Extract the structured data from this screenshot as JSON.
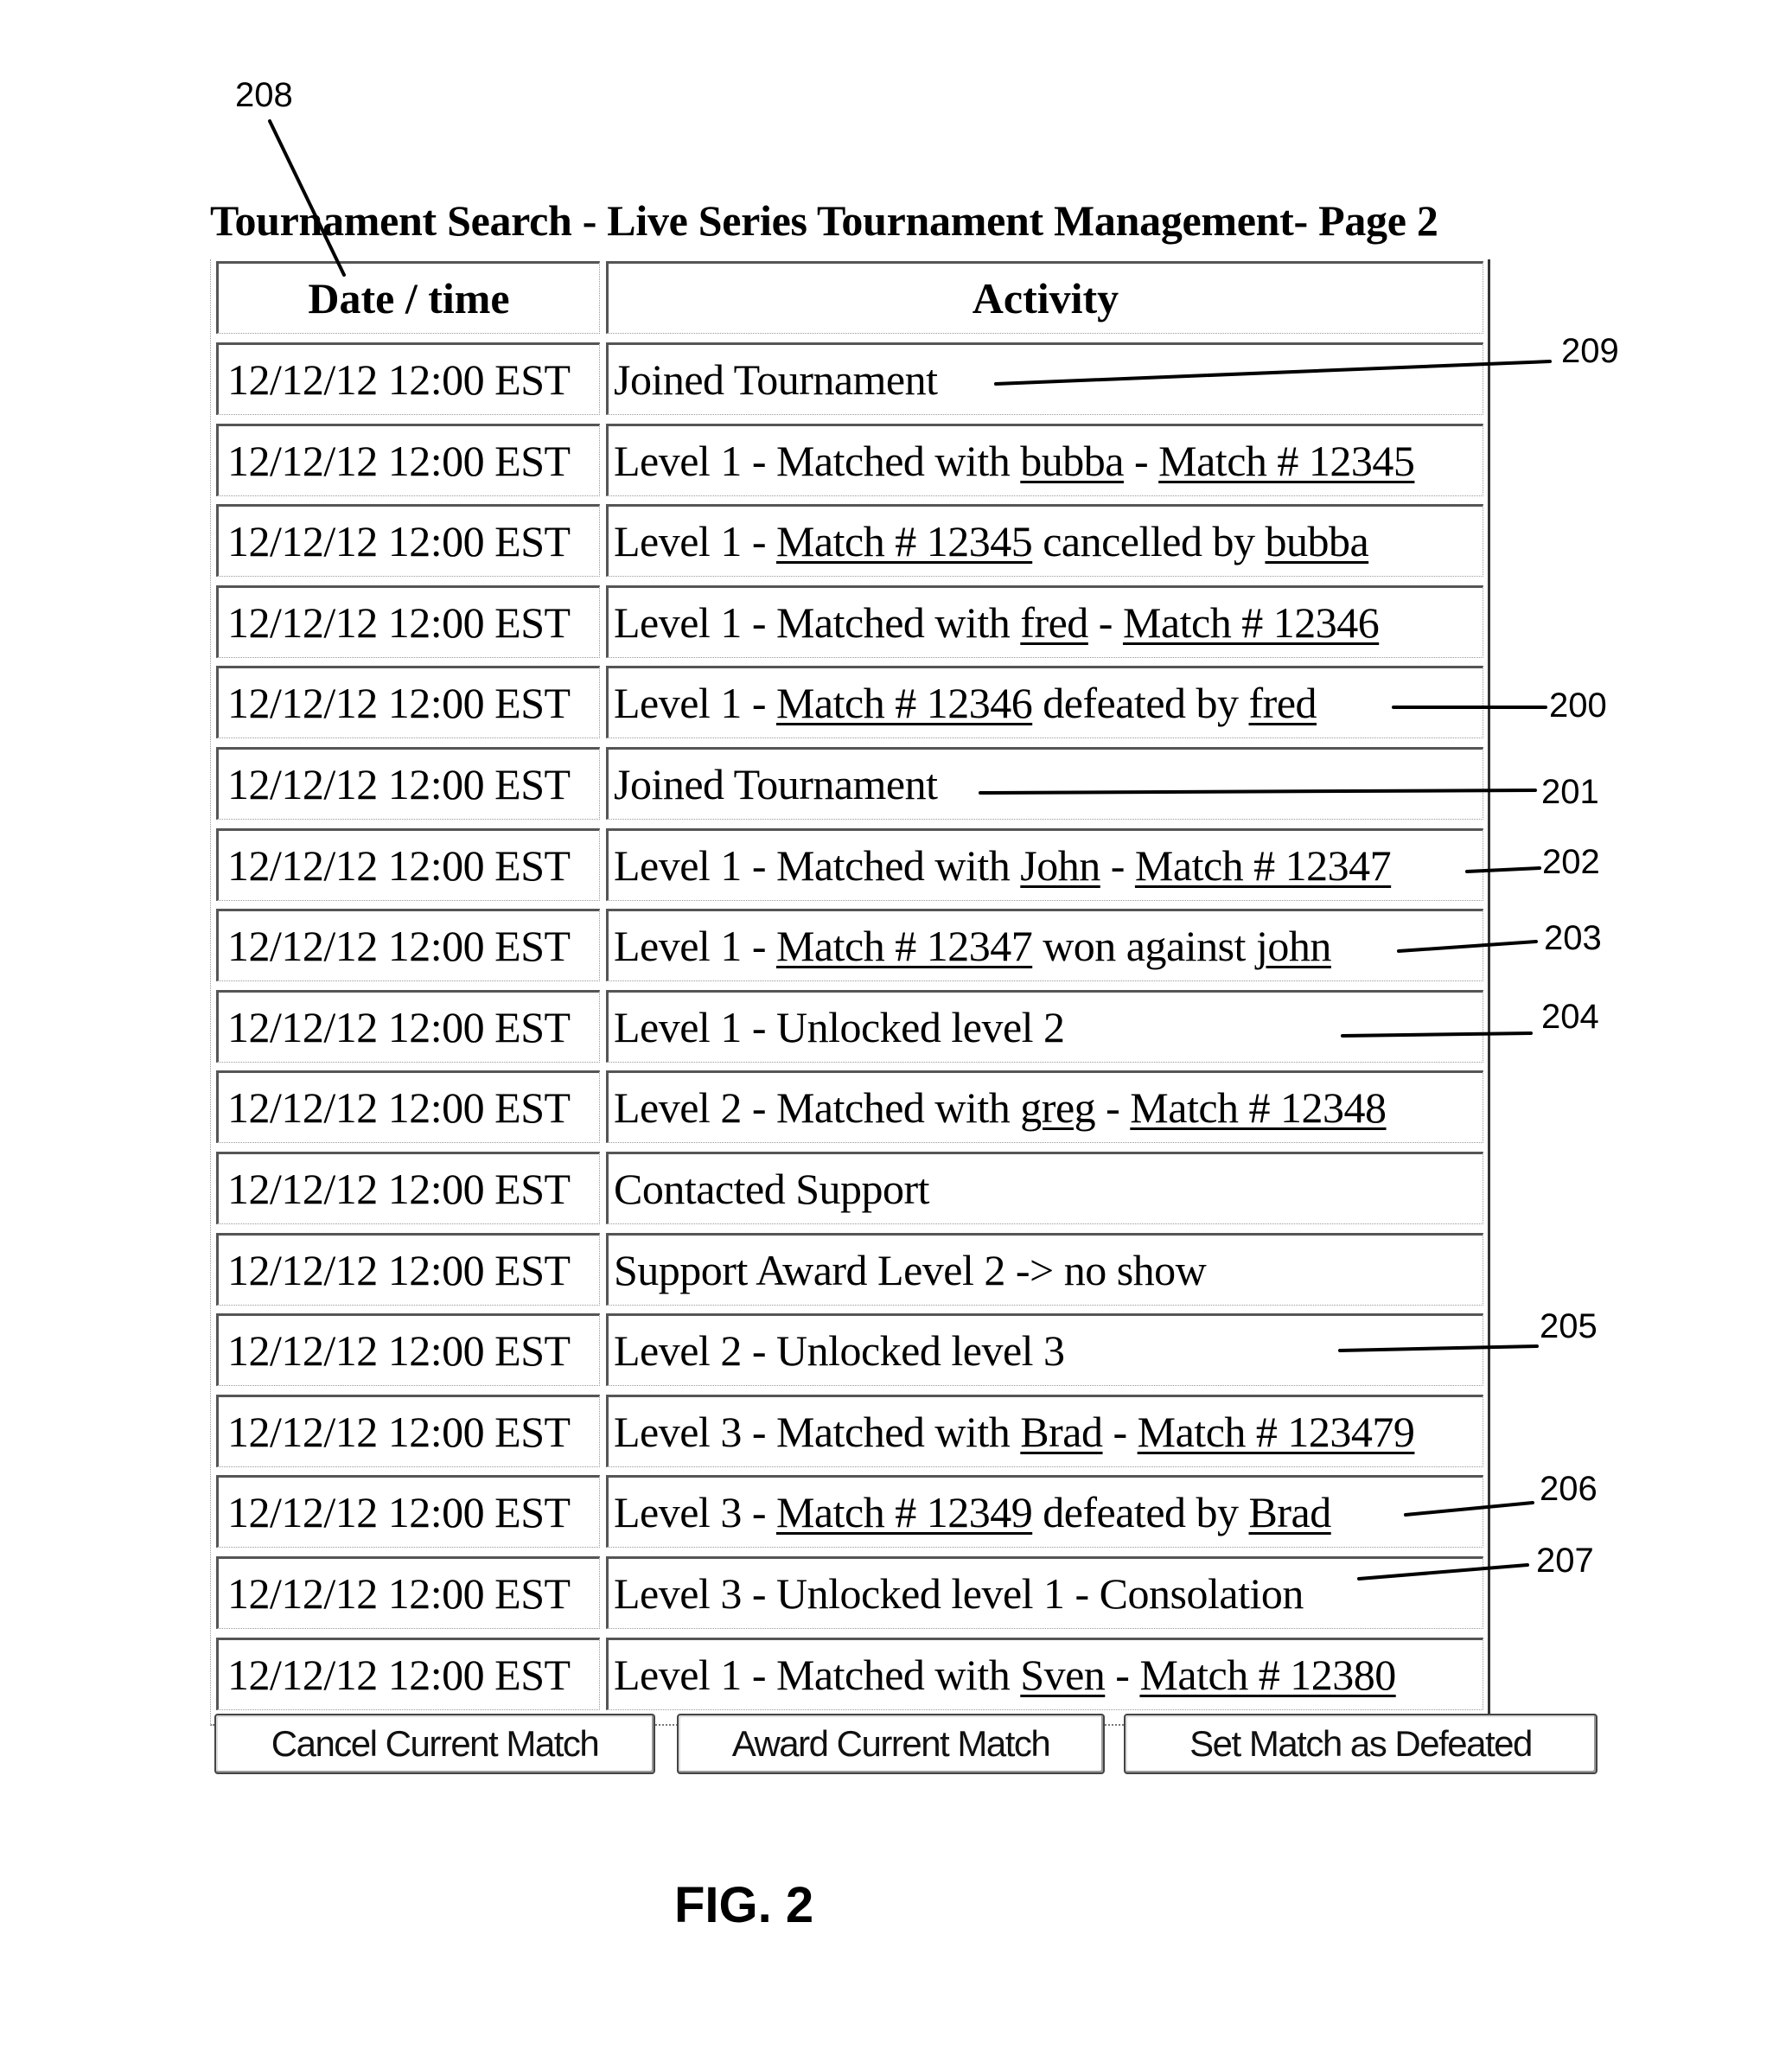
{
  "page": {
    "title": "Tournament Search - Live Series Tournament Management- Page 2",
    "figure_label": "FIG. 2"
  },
  "table": {
    "headers": [
      "Date / time",
      "Activity"
    ],
    "rows": [
      {
        "datetime": "12/12/12 12:00 EST",
        "activity": [
          {
            "t": "Joined Tournament"
          }
        ]
      },
      {
        "datetime": "12/12/12 12:00 EST",
        "activity": [
          {
            "t": "Level 1 - Matched with "
          },
          {
            "t": "bubba",
            "link": true
          },
          {
            "t": " - "
          },
          {
            "t": "Match # 12345",
            "link": true
          }
        ]
      },
      {
        "datetime": "12/12/12 12:00 EST",
        "activity": [
          {
            "t": "Level 1 - "
          },
          {
            "t": "Match # 12345",
            "link": true
          },
          {
            "t": " cancelled by "
          },
          {
            "t": "bubba",
            "link": true
          }
        ]
      },
      {
        "datetime": "12/12/12 12:00 EST",
        "activity": [
          {
            "t": "Level 1 - Matched with "
          },
          {
            "t": "fred",
            "link": true
          },
          {
            "t": " - "
          },
          {
            "t": "Match # 12346",
            "link": true
          }
        ]
      },
      {
        "datetime": "12/12/12 12:00 EST",
        "activity": [
          {
            "t": "Level 1 - "
          },
          {
            "t": "Match # 12346",
            "link": true
          },
          {
            "t": " defeated by "
          },
          {
            "t": "fred",
            "link": true
          }
        ]
      },
      {
        "datetime": "12/12/12 12:00 EST",
        "activity": [
          {
            "t": "Joined Tournament"
          }
        ]
      },
      {
        "datetime": "12/12/12 12:00 EST",
        "activity": [
          {
            "t": "Level 1 - Matched with "
          },
          {
            "t": "John",
            "link": true
          },
          {
            "t": " - "
          },
          {
            "t": "Match # 12347",
            "link": true
          }
        ]
      },
      {
        "datetime": "12/12/12 12:00 EST",
        "activity": [
          {
            "t": "Level 1 - "
          },
          {
            "t": "Match # 12347",
            "link": true
          },
          {
            "t": " won against "
          },
          {
            "t": "john",
            "link": true
          }
        ]
      },
      {
        "datetime": "12/12/12 12:00 EST",
        "activity": [
          {
            "t": "Level 1 - Unlocked level 2"
          }
        ]
      },
      {
        "datetime": "12/12/12 12:00 EST",
        "activity": [
          {
            "t": "Level 2 - Matched with "
          },
          {
            "t": "greg",
            "link": true
          },
          {
            "t": " - "
          },
          {
            "t": "Match # 12348",
            "link": true
          }
        ]
      },
      {
        "datetime": "12/12/12 12:00 EST",
        "activity": [
          {
            "t": "Contacted Support"
          }
        ]
      },
      {
        "datetime": "12/12/12 12:00 EST",
        "activity": [
          {
            "t": "Support Award Level 2 -> no show"
          }
        ]
      },
      {
        "datetime": "12/12/12 12:00 EST",
        "activity": [
          {
            "t": "Level 2 - Unlocked level 3"
          }
        ]
      },
      {
        "datetime": "12/12/12 12:00 EST",
        "activity": [
          {
            "t": "Level 3 - Matched with "
          },
          {
            "t": "Brad",
            "link": true
          },
          {
            "t": " - "
          },
          {
            "t": "Match # 123479",
            "link": true
          }
        ]
      },
      {
        "datetime": "12/12/12 12:00 EST",
        "activity": [
          {
            "t": "Level 3 - "
          },
          {
            "t": "Match # 12349",
            "link": true
          },
          {
            "t": " defeated by "
          },
          {
            "t": "Brad",
            "link": true
          }
        ]
      },
      {
        "datetime": "12/12/12 12:00 EST",
        "activity": [
          {
            "t": "Level 3 - Unlocked level 1 - Consolation"
          }
        ]
      },
      {
        "datetime": "12/12/12 12:00 EST",
        "activity": [
          {
            "t": "Level 1 - Matched with "
          },
          {
            "t": "Sven",
            "link": true
          },
          {
            "t": " - "
          },
          {
            "t": "Match # 12380",
            "link": true
          }
        ]
      }
    ]
  },
  "buttons": {
    "cancel_match": "Cancel Current Match",
    "award_match": "Award Current Match",
    "set_defeated": "Set Match as Defeated"
  },
  "callouts": {
    "c208": "208",
    "c209": "209",
    "c200": "200",
    "c201": "201",
    "c202": "202",
    "c203": "203",
    "c204": "204",
    "c205": "205",
    "c206": "206",
    "c207": "207"
  }
}
